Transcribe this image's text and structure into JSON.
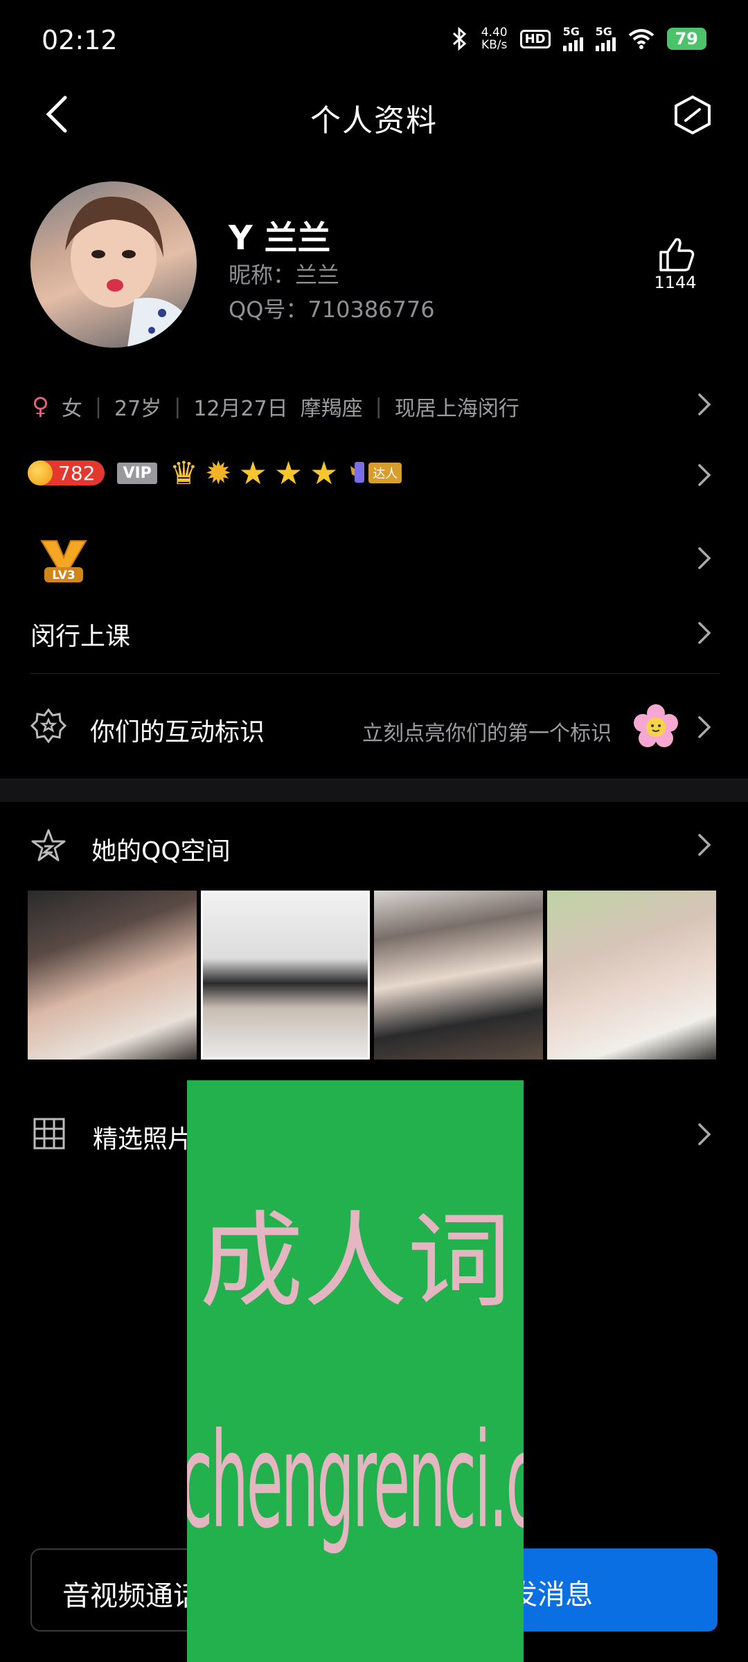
{
  "status_bar": {
    "time": "02:12",
    "net_speed_value": "4.40",
    "net_speed_unit": "KB/s",
    "hd_label": "HD",
    "sim1_label": "5G",
    "sim2_label": "5G",
    "battery": "79",
    "icons": [
      "bluetooth-icon",
      "hd-volte-icon",
      "signal-icon",
      "signal-icon",
      "wifi-icon",
      "battery-icon"
    ]
  },
  "header": {
    "title": "个人资料"
  },
  "profile": {
    "name": "Y 兰兰",
    "nickname": "昵称：兰兰",
    "qq": "QQ号：710386776",
    "likes": "1144"
  },
  "info_line": {
    "gender_symbol": "♀",
    "gender": "女",
    "age": "27岁",
    "birthday": "12月27日",
    "zodiac": "摩羯座",
    "location": "现居上海闵行",
    "separator": "|"
  },
  "badges": {
    "coin_value": "782",
    "vip_label": "VIP",
    "daren_label": "达人",
    "crown_glyph": "♛",
    "sun_glyph": "✹",
    "star_glyph": "★"
  },
  "level": {
    "label": "LV3"
  },
  "school": "闵行上课",
  "interaction": {
    "label": "你们的互动标识",
    "hint": "立刻点亮你们的第一个标识"
  },
  "qzone": {
    "label": "她的QQ空间",
    "photos": [
      "photo-1",
      "photo-2",
      "photo-3",
      "photo-4"
    ]
  },
  "selected_photos": {
    "label": "精选照片"
  },
  "actions": {
    "av_call": "音视频通话",
    "send_message": "发消息"
  },
  "watermark": {
    "cn": "成人词",
    "en": "chengrenci.com"
  },
  "colors": {
    "background": "#000000",
    "accent_blue": "#0a6fe2",
    "watermark_green": "#22b14c",
    "battery_green": "#4cc36b",
    "female_pink": "#e0617c"
  }
}
